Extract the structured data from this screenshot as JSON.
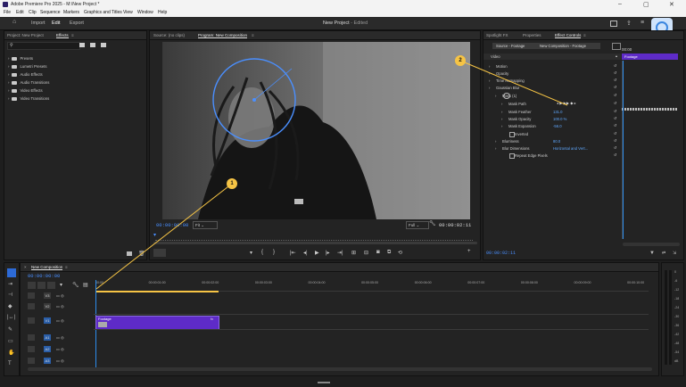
{
  "window": {
    "title": "Adobe Premiere Pro 2025 - M:\\New Project *",
    "controls": [
      "–",
      "▢",
      "✕"
    ]
  },
  "menu": [
    "File",
    "Edit",
    "Clip",
    "Sequence",
    "Markers",
    "Graphics and Titles",
    "View",
    "Window",
    "Help"
  ],
  "topbar": {
    "tabs": [
      "Import",
      "Edit",
      "Export"
    ],
    "active_tab": "Edit",
    "project_title": "New Project",
    "edited": "- Edited"
  },
  "left_panel": {
    "tabs": [
      "Project: New Project",
      "Effects"
    ],
    "active": "Effects",
    "menu_glyph": "≡",
    "items": [
      "Presets",
      "Lumetri Presets",
      "Audio Effects",
      "Audio Transitions",
      "Video Effects",
      "Video Transitions"
    ]
  },
  "program_monitor": {
    "tabs": [
      "Source: (no clips)",
      "Program: New Composition"
    ],
    "active": "Program: New Composition",
    "timecode_left": "00:00:00:00",
    "fit": "Fit",
    "quality": "Full",
    "timecode_right": "00:00:02:11"
  },
  "effect_controls": {
    "tabs": [
      "Lumetri Color",
      "Spotlight FX",
      "Properties",
      "Effect Controls"
    ],
    "active": "Effect Controls",
    "source": "Source - Footage",
    "sequence": "New Composition - Footage",
    "clip_timecode": "00:00",
    "clip_label": "Footage",
    "video_header": "Video",
    "rows": [
      {
        "name": "Motion",
        "indent": 1
      },
      {
        "name": "Opacity",
        "indent": 1
      },
      {
        "name": "Time Remapping",
        "indent": 1
      },
      {
        "name": "Gaussian Blur",
        "indent": 1
      },
      {
        "name": "Mask (1)",
        "indent": 2
      },
      {
        "name": "Mask Path",
        "indent": 3
      },
      {
        "name": "Mask Feather",
        "indent": 3,
        "value": "131.0"
      },
      {
        "name": "Mask Opacity",
        "indent": 3,
        "value": "100.0 %"
      },
      {
        "name": "Mask Expansion",
        "indent": 3,
        "value": "-56.0"
      },
      {
        "name": "Inverted",
        "indent": 4
      },
      {
        "name": "Blurriness",
        "indent": 2,
        "value": "80.0"
      },
      {
        "name": "Blur Dimensions",
        "indent": 2,
        "value": "Horizontal and Vert..."
      },
      {
        "name": "Repeat Edge Pixels",
        "indent": 4
      }
    ],
    "footer_timecode": "00:00:02:11"
  },
  "timeline": {
    "sequence_name": "New Composition",
    "timecode": "00:00:00:00",
    "ruler": [
      "00:00",
      "00:00:01:00",
      "00:00:02:00",
      "00:00:03:00",
      "00:00:04:00",
      "00:00:05:00",
      "00:00:06:00",
      "00:00:07:00",
      "00:00:08:00",
      "00:00:09:00",
      "00:00:10:00"
    ],
    "tracks": [
      "V3",
      "V2",
      "V1",
      "A1",
      "A2",
      "A3"
    ],
    "clip_name": "Footage",
    "clip_fx": "fx"
  },
  "meter_scale": [
    "0",
    "-6",
    "-12",
    "-18",
    "-24",
    "-30",
    "-36",
    "-42",
    "-48",
    "-54",
    "dB"
  ],
  "callouts": [
    "1",
    "2"
  ],
  "colors": {
    "accent": "#2d8ceb",
    "clip": "#5e2bc8",
    "callout": "#f6c445"
  }
}
